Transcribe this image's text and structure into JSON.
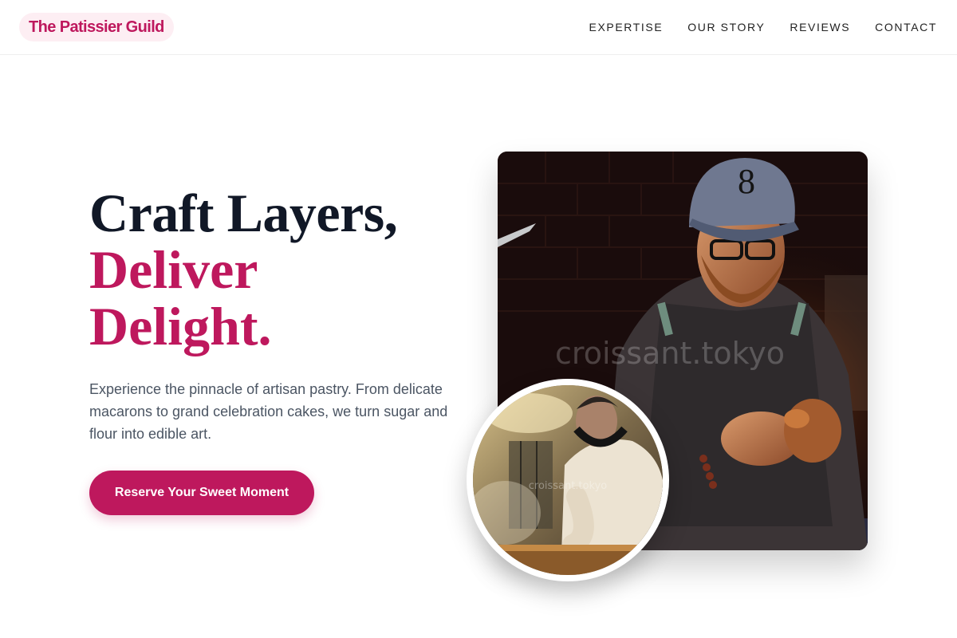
{
  "brand": {
    "name": "The Patissier Guild"
  },
  "nav": {
    "items": [
      {
        "label": "EXPERTISE"
      },
      {
        "label": "OUR STORY"
      },
      {
        "label": "REVIEWS"
      },
      {
        "label": "CONTACT"
      }
    ]
  },
  "hero": {
    "title_line1": "Craft Layers,",
    "title_line2": "Deliver",
    "title_line3": "Delight.",
    "lead": "Experience the pinnacle of artisan pastry. From delicate macarons to grand celebration cakes, we turn sugar and flour into edible art.",
    "cta_label": "Reserve Your Sweet Moment"
  },
  "images": {
    "main_watermark": "croissant.tokyo",
    "thumb_watermark": "croissant.tokyo"
  },
  "colors": {
    "accent": "#be185d",
    "heading": "#111827",
    "body_text": "#4b5563",
    "logo_bg": "#fdeef3"
  }
}
